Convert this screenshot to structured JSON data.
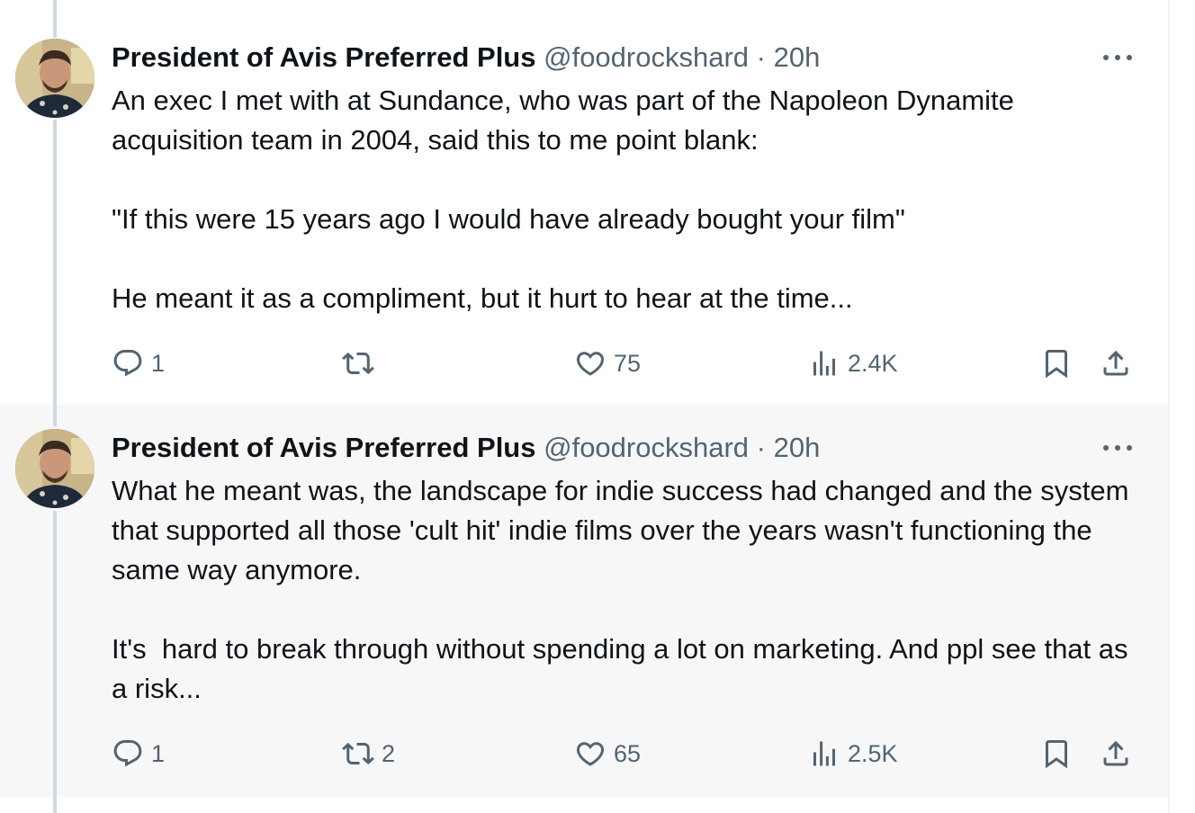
{
  "tweets": [
    {
      "author_name": "President of Avis Preferred Plus",
      "handle": "@foodrockshard",
      "separator": "·",
      "time": "20h",
      "text": "An exec I met with at Sundance, who was part of the Napoleon Dynamite acquisition team in 2004, said this to me point blank:\n\n\"If this were 15 years ago I would have already bought your film\"\n\nHe meant it as a compliment, but it hurt to hear at the time...",
      "replies": "1",
      "retweets": "",
      "likes": "75",
      "views": "2.4K"
    },
    {
      "author_name": "President of Avis Preferred Plus",
      "handle": "@foodrockshard",
      "separator": "·",
      "time": "20h",
      "text": "What he meant was, the landscape for indie success had changed and the system that supported all those 'cult hit' indie films over the years wasn't functioning the same way anymore.\n\nIt's  hard to break through without spending a lot on marketing. And ppl see that as a risk...",
      "replies": "1",
      "retweets": "2",
      "likes": "65",
      "views": "2.5K"
    }
  ],
  "icons": {
    "reply": "reply-icon",
    "retweet": "retweet-icon",
    "like": "heart-icon",
    "views": "views-icon",
    "bookmark": "bookmark-icon",
    "share": "share-icon",
    "more": "more-icon"
  },
  "colors": {
    "text": "#0f1419",
    "secondary": "#536471",
    "thread_line": "#cfd9de",
    "highlight_bg": "#f7f7f7"
  }
}
